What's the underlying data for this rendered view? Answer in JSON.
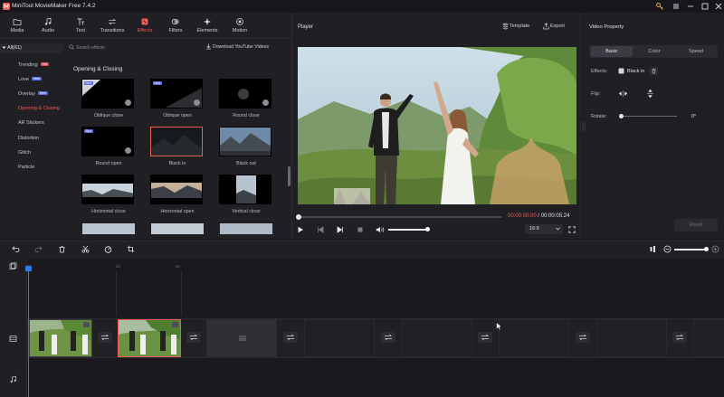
{
  "app": {
    "title": "MiniTool MovieMaker Free 7.4.2"
  },
  "toolbar": {
    "items": [
      {
        "label": "Media"
      },
      {
        "label": "Audio"
      },
      {
        "label": "Text"
      },
      {
        "label": "Transitions"
      },
      {
        "label": "Effects"
      },
      {
        "label": "Filters"
      },
      {
        "label": "Elements"
      },
      {
        "label": "Motion"
      }
    ],
    "active": "Effects",
    "accent_color": "#f25c54"
  },
  "categories": {
    "all_label": "All(61)",
    "items": [
      {
        "label": "Trending",
        "badge": "Hot"
      },
      {
        "label": "Love",
        "badge": "New"
      },
      {
        "label": "Overlay",
        "badge": "New"
      },
      {
        "label": "Opening & Closing"
      },
      {
        "label": "AR Stickers"
      },
      {
        "label": "Distortion"
      },
      {
        "label": "Glitch"
      },
      {
        "label": "Particle"
      }
    ],
    "active": "Opening & Closing"
  },
  "effects": {
    "search_placeholder": "Search effects",
    "download_label": "Download YouTube Videos",
    "section_title": "Opening & Closing",
    "new_tag": "New",
    "items": [
      {
        "label": "Oblique close"
      },
      {
        "label": "Oblique open"
      },
      {
        "label": "Round close"
      },
      {
        "label": "Round open"
      },
      {
        "label": "Black in"
      },
      {
        "label": "Black out"
      },
      {
        "label": "Horizontal close"
      },
      {
        "label": "Horizontal open"
      },
      {
        "label": "Vertical close"
      }
    ],
    "selected": "Black in"
  },
  "player": {
    "title": "Player",
    "template_label": "Template",
    "export_label": "Export",
    "current_time": "00:00:00:00",
    "separator": " / ",
    "total_time": "00:00:05:24",
    "aspect_ratio": "16:9"
  },
  "property": {
    "title": "Video Property",
    "tabs": [
      {
        "label": "Basic"
      },
      {
        "label": "Color"
      },
      {
        "label": "Speed"
      }
    ],
    "active_tab": "Basic",
    "effects_label": "Effects:",
    "effect_value": "Black in",
    "flip_label": "Flip:",
    "rotate_label": "Rotate:",
    "rotate_value": "0°",
    "reset_label": "Reset"
  },
  "timeline": {
    "ruler_ticks": [
      "0s",
      "3s",
      "6s"
    ]
  }
}
